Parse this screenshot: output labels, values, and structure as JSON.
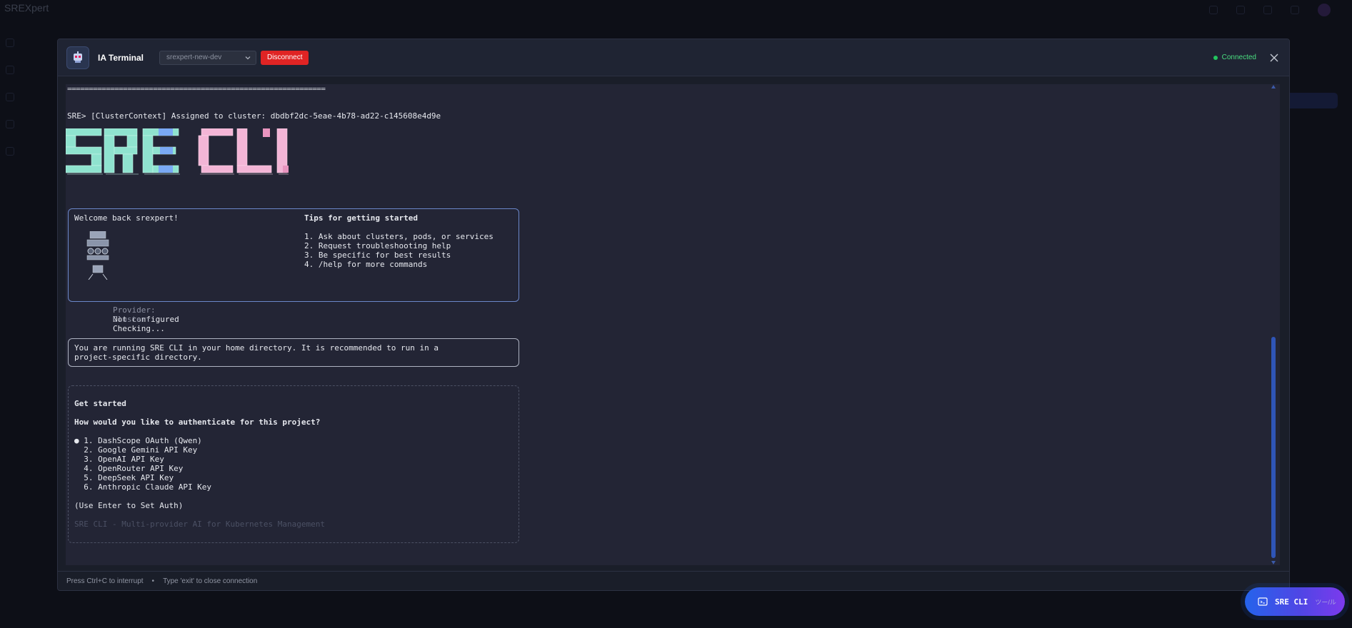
{
  "background": {
    "app_title": "SREXpert"
  },
  "modal": {
    "title": "IA Terminal",
    "connection_select_value": "srexpert-new-dev",
    "disconnect_label": "Disconnect",
    "status_text": "Connected",
    "status_color": "#22c55e"
  },
  "terminal": {
    "separator": "============================================================",
    "cluster_line": "SRE> [ClusterContext] Assigned to cluster: dbdbf2dc-5eae-4b78-ad22-c145608e4d9e",
    "banner_colors": {
      "sre": "#8fe3cf",
      "sre_accent": "#7aa9f5",
      "cli": "#f3b5d6"
    },
    "welcome": {
      "greeting": "Welcome back srexpert!",
      "provider_label": "Provider:",
      "provider_value": "Not configured",
      "cluster_label": "Cluster:",
      "cluster_value": "Checking...",
      "tips_title": "Tips for getting started",
      "tips": [
        "1. Ask about clusters, pods, or services",
        "2. Request troubleshooting help",
        "3. Be specific for best results",
        "4. /help for more commands"
      ]
    },
    "warning": "You are running SRE CLI in your home directory. It is recommended to run in a\nproject-specific directory.",
    "get_started": {
      "title": "Get started",
      "question": "How would you like to authenticate for this project?",
      "options": [
        "● 1. DashScope OAuth (Qwen)",
        "  2. Google Gemini API Key",
        "  3. OpenAI API Key",
        "  4. OpenRouter API Key",
        "  5. DeepSeek API Key",
        "  6. Anthropic Claude API Key"
      ],
      "hint": "(Use Enter to Set Auth)",
      "footer": "SRE CLI - Multi-provider AI for Kubernetes Management"
    }
  },
  "footer": {
    "interrupt_hint": "Press Ctrl+C to interrupt",
    "separator": "•",
    "exit_hint": "Type 'exit' to close connection"
  },
  "fab": {
    "label": "SRE CLI",
    "extra": "ツー/ル"
  }
}
